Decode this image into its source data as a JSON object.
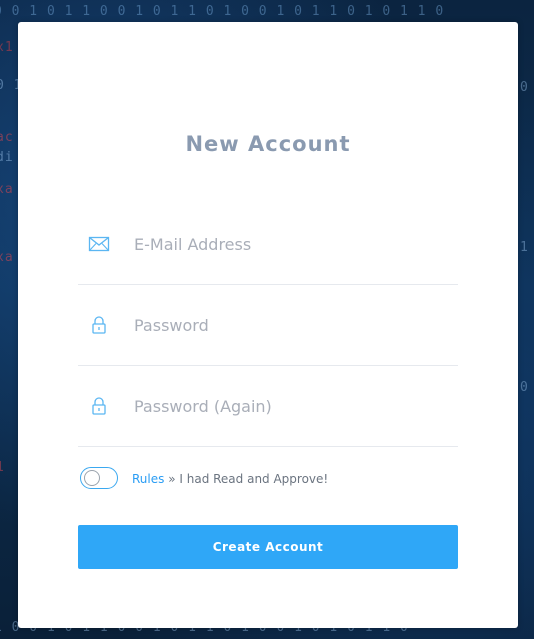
{
  "form": {
    "title": "New Account",
    "fields": [
      {
        "placeholder": "E-Mail Address",
        "value": "",
        "icon": "envelope-icon"
      },
      {
        "placeholder": "Password",
        "value": "",
        "icon": "lock-icon"
      },
      {
        "placeholder": "Password (Again)",
        "value": "",
        "icon": "lock-icon"
      }
    ],
    "rules": {
      "link_label": "Rules",
      "separator": "»",
      "text": "I had Read and Approve!",
      "toggle_on": false
    },
    "submit_label": "Create Account"
  },
  "colors": {
    "accent": "#2fa7f7",
    "title": "#8a9ab0",
    "icon": "#5bb6f2",
    "background": "#0d2f52"
  }
}
